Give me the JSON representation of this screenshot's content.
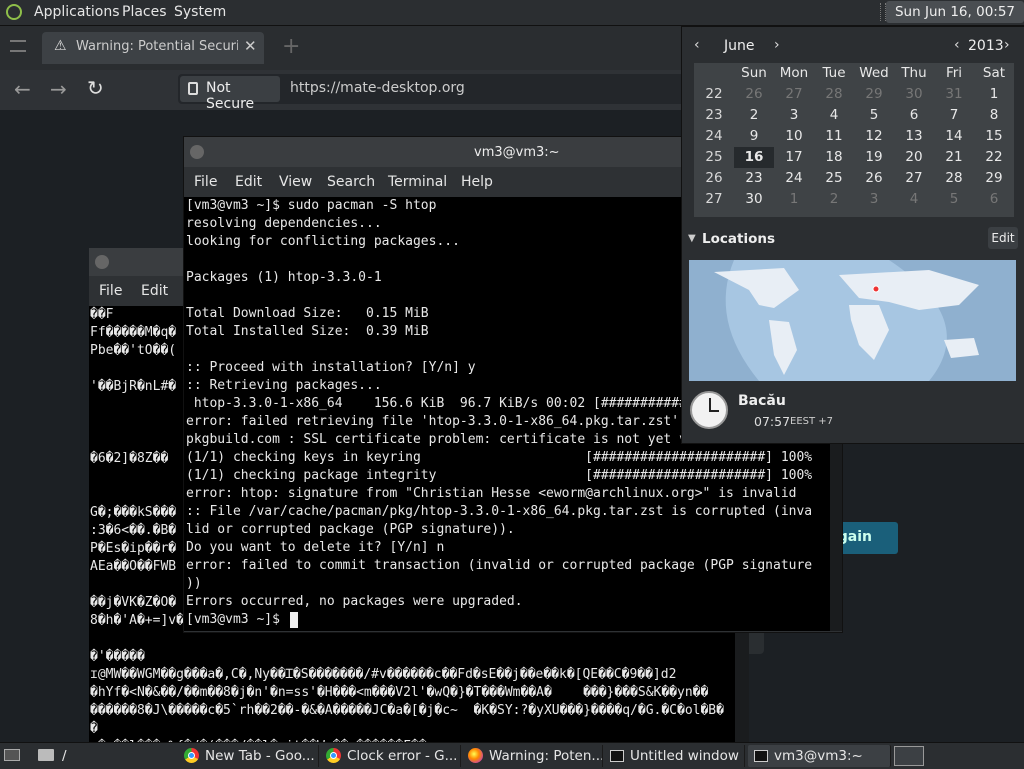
{
  "top_panel": {
    "menus": [
      "Applications",
      "Places",
      "System"
    ],
    "clock": "Sun Jun 16, 00:57"
  },
  "firefox": {
    "tab_title": "Warning: Potential Security",
    "not_secure": "Not Secure",
    "url": "https://mate-desktop.org",
    "try_again": "Try Again"
  },
  "terminal_main": {
    "title": "vm3@vm3:~",
    "menus": [
      "File",
      "Edit",
      "View",
      "Search",
      "Terminal",
      "Help"
    ],
    "lines": [
      "[vm3@vm3 ~]$ sudo pacman -S htop",
      "resolving dependencies...",
      "looking for conflicting packages...",
      "",
      "Packages (1) htop-3.3.0-1",
      "",
      "Total Download Size:   0.15 MiB",
      "Total Installed Size:  0.39 MiB",
      "",
      ":: Proceed with installation? [Y/n] y",
      ":: Retrieving packages...",
      " htop-3.3.0-1-x86_64    156.6 KiB  96.7 KiB/s 00:02 [######################] 100%",
      "error: failed retrieving file 'htop-3.3.0-1-x86_64.pkg.tar.zst' from mirror.",
      "pkgbuild.com : SSL certificate problem: certificate is not yet valid",
      "(1/1) checking keys in keyring                     [######################] 100%",
      "(1/1) checking package integrity                   [######################] 100%",
      "error: htop: signature from \"Christian Hesse <eworm@archlinux.org>\" is invalid",
      ":: File /var/cache/pacman/pkg/htop-3.3.0-1-x86_64.pkg.tar.zst is corrupted (inva",
      "lid or corrupted package (PGP signature)).",
      "Do you want to delete it? [Y/n] n",
      "error: failed to commit transaction (invalid or corrupted package (PGP signature",
      "))",
      "Errors occurred, no packages were upgraded.",
      "[vm3@vm3 ~]$ "
    ]
  },
  "terminal_back": {
    "menus": [
      "File",
      "Edit"
    ],
    "lines": [
      "��F",
      "Ff�����M�q�",
      "Pbe��'tO��(",
      "",
      "'��BjR�nL#�",
      "",
      "",
      "",
      "�6�2]�8Z��",
      "",
      "",
      "G�;���kS���",
      ":3�6<��.�B�",
      "P�Es�ip��r�",
      "AEa��O��FWB",
      "",
      "��j�VK�Z�O�",
      "8�h�'A�+=]v�",
      "",
      "�'�����",
      "ɪ@MW��WGM��g���a�,C�,Ny��Ɪ�S�������/#v������c��Fd�sE��j��e��k�[QE��C�9��]d2",
      "�hYf�<N�&��/��m��8�j�n'�n=ss'�H���<m���V2l'�wQ�}�T���Wm��A�    ���}���S&K��yn��",
      "������8�J\\�����c�5`rh��2��-�&�A�����JC�a�[�j�c~  �K�SY:?�yXU���}����q/�G.�C�ol�B�",
      "�",
      " �<��l���_%{�/�(���/��l�cit��W,��.������F��a",
      "                                          ,�g[        hcf�$/�b��u���,�my5"
    ]
  },
  "calendar": {
    "month": "June",
    "year": "2013",
    "weekdays": [
      "Sun",
      "Mon",
      "Tue",
      "Wed",
      "Thu",
      "Fri",
      "Sat"
    ],
    "weeks": [
      {
        "num": "22",
        "days": [
          "26",
          "27",
          "28",
          "29",
          "30",
          "31",
          "1"
        ]
      },
      {
        "num": "23",
        "days": [
          "2",
          "3",
          "4",
          "5",
          "6",
          "7",
          "8"
        ]
      },
      {
        "num": "24",
        "days": [
          "9",
          "10",
          "11",
          "12",
          "13",
          "14",
          "15"
        ]
      },
      {
        "num": "25",
        "days": [
          "16",
          "17",
          "18",
          "19",
          "20",
          "21",
          "22"
        ]
      },
      {
        "num": "26",
        "days": [
          "23",
          "24",
          "25",
          "26",
          "27",
          "28",
          "29"
        ]
      },
      {
        "num": "27",
        "days": [
          "30",
          "1",
          "2",
          "3",
          "4",
          "5",
          "6"
        ]
      }
    ],
    "today": "16",
    "locations_label": "Locations",
    "edit_label": "Edit",
    "city": "Bacău",
    "city_time": "07:57",
    "city_tz": "EEST +7"
  },
  "taskbar": {
    "path": "/",
    "tasks": [
      "New Tab - Goo...",
      "Clock error - G...",
      "Warning: Poten...",
      "Untitled window",
      "vm3@vm3:~"
    ]
  },
  "colors": {
    "panel": "#2b2e31",
    "terminal_bg": "#000000",
    "accent": "#1a5f7a"
  }
}
